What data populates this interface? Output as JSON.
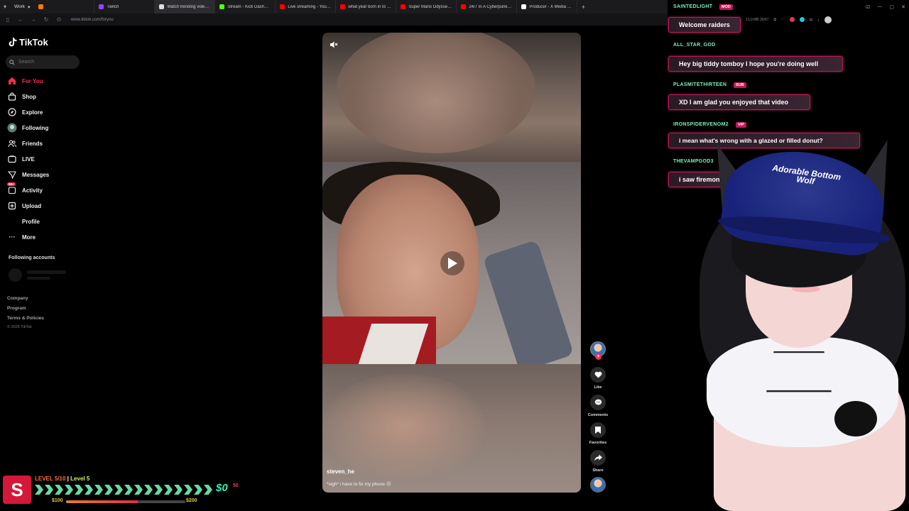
{
  "browser": {
    "workspace": "Work",
    "tabs": [
      {
        "label": "",
        "color": "#ff7a00"
      },
      {
        "label": "Twitch",
        "color": "#9146ff"
      },
      {
        "label": "Watch trending videos for y",
        "color": "#dddddd"
      },
      {
        "label": "Stream - Kick Dashboard",
        "color": "#53fc18"
      },
      {
        "label": "Live streaming - YouTub...",
        "color": "#ff0000"
      },
      {
        "label": "what year born in to be o...",
        "color": "#ff0000"
      },
      {
        "label": "Super Mario Odyssey - F...",
        "color": "#ff0000"
      },
      {
        "label": "24/7 In A Cyberpunk Apa...",
        "color": "#ff0000"
      },
      {
        "label": "Producer - X Media Studio",
        "color": "#ffffff"
      }
    ],
    "url": "www.tiktok.com/foryou",
    "stats": "13.9 MB  35/67"
  },
  "tiktok": {
    "logo_text": "TikTok",
    "search_placeholder": "Search",
    "nav": [
      {
        "label": "For You",
        "icon": "home-icon"
      },
      {
        "label": "Shop",
        "icon": "shop-icon"
      },
      {
        "label": "Explore",
        "icon": "compass-icon"
      },
      {
        "label": "Following",
        "icon": "following-avatar-icon"
      },
      {
        "label": "Friends",
        "icon": "friends-icon"
      },
      {
        "label": "LIVE",
        "icon": "live-icon"
      },
      {
        "label": "Messages",
        "icon": "messages-icon"
      },
      {
        "label": "Activity",
        "icon": "activity-icon",
        "badge": "99+"
      },
      {
        "label": "Upload",
        "icon": "upload-icon"
      },
      {
        "label": "Profile",
        "icon": "profile-icon"
      },
      {
        "label": "More",
        "icon": "more-icon"
      }
    ],
    "following_accounts_title": "Following accounts",
    "footer_links": [
      "Company",
      "Program",
      "Terms & Policies"
    ],
    "copyright": "© 2025 TikTok",
    "video": {
      "author": "steven_he",
      "caption": "*sigh* i have to fix my phone 😐"
    },
    "actions": {
      "like": "Like",
      "comments": "Comments",
      "favorites": "Favorites",
      "share": "Share"
    }
  },
  "chat": [
    {
      "name": "SAINTEDLIGHT",
      "tag": "MOD",
      "message": "Welcome raiders"
    },
    {
      "name": "ALL_STAR_GOD",
      "tag": "",
      "message": "Hey big tiddy tomboy I hope you're doing well"
    },
    {
      "name": "PLASMITETHIRTEEN",
      "tag": "SUB",
      "message": "XD I am glad you enjoyed that video"
    },
    {
      "name": "IRONSPIDERVENOM2",
      "tag": "VIP",
      "message": "i mean what's wrong with a glazed or filled donut?"
    },
    {
      "name": "THEVAMPGOD3",
      "tag": "",
      "message": "i saw firemon"
    }
  ],
  "vtuber": {
    "hat_text": "Adorable Bottom Wolf"
  },
  "stream_bar": {
    "logo_letter": "S",
    "level_label": "LEVEL 5/10",
    "level_sep": "|",
    "level_name": "Level 5",
    "money": "$0",
    "money_sup": "50",
    "goal_low": "$100",
    "goal_high": "$200",
    "goal_progress": 0.0
  },
  "colors": {
    "tiktok_accent": "#fe2c55",
    "chat_name": "#7ff1b8",
    "chat_border": "#c2185b",
    "stream_logo": "#d3183a"
  }
}
